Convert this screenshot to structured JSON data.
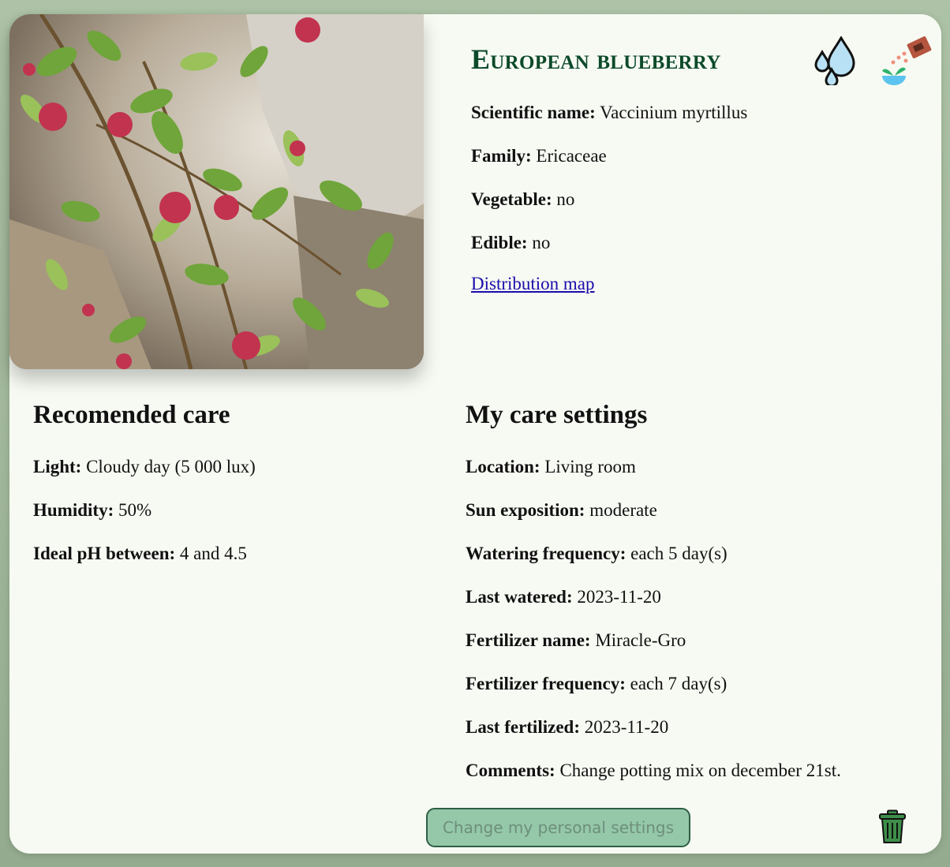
{
  "plant": {
    "title": "European blueberry",
    "info": [
      {
        "label": "Scientific name:",
        "value": "Vaccinium myrtillus"
      },
      {
        "label": "Family:",
        "value": "Ericaceae"
      },
      {
        "label": "Vegetable:",
        "value": "no"
      },
      {
        "label": "Edible:",
        "value": "no"
      }
    ],
    "map_link": "Distribution map"
  },
  "icons": {
    "watering": "water-drops-icon",
    "fertilizer": "fertilizer-bag-icon",
    "delete": "trash-icon"
  },
  "recommended": {
    "heading": "Recomended care",
    "items": [
      {
        "label": "Light:",
        "value": "Cloudy day (5 000 lux)"
      },
      {
        "label": "Humidity:",
        "value": "50%"
      },
      {
        "label": "Ideal pH between:",
        "value": "4 and 4.5"
      }
    ]
  },
  "settings": {
    "heading": "My care settings",
    "items": [
      {
        "label": "Location:",
        "value": "Living room"
      },
      {
        "label": "Sun exposition:",
        "value": "moderate"
      },
      {
        "label": "Watering frequency:",
        "value": "each 5 day(s)"
      },
      {
        "label": "Last watered:",
        "value": "2023-11-20"
      },
      {
        "label": "Fertilizer name:",
        "value": "Miracle-Gro"
      },
      {
        "label": "Fertilizer frequency:",
        "value": "each 7 day(s)"
      },
      {
        "label": "Last fertilized:",
        "value": "2023-11-20"
      },
      {
        "label": "Comments:",
        "value": "Change potting mix on december 21st."
      }
    ],
    "button_label": "Change my personal settings"
  },
  "colors": {
    "title": "#0c4a2a",
    "button_bg": "#95c8a9",
    "button_border": "#2f5e45",
    "card_bg": "#f7faf3"
  }
}
